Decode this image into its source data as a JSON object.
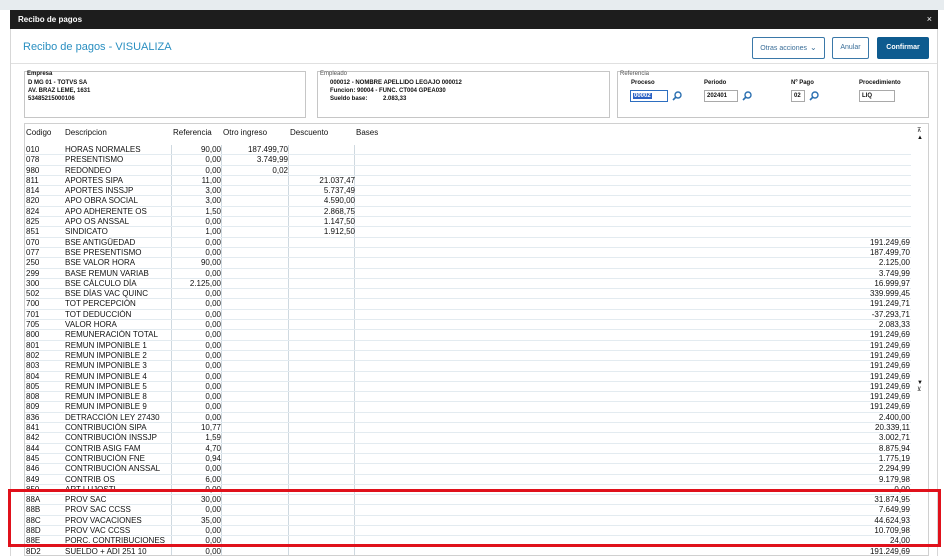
{
  "window": {
    "title": "Recibo de pagos",
    "close_glyph": "×"
  },
  "page": {
    "title": "Recibo de pagos - VISUALIZA"
  },
  "actions": {
    "otras_acciones": "Otras acciones",
    "anular": "Anular",
    "confirmar": "Confirmar"
  },
  "empresa": {
    "label": "Empresa",
    "line1": "D MG 01  - TOTVS SA",
    "line2": "AV. BRAZ LEME, 1631",
    "line3": "53485215000106"
  },
  "empleado": {
    "label": "Empleado",
    "line1": "000012 - NOMBRE  APELLIDO LEGAJO 000012",
    "line2": "Funcion: 90004 - FUNC. CT004 GPEA030",
    "sueldo_label": "Sueldo base:",
    "sueldo_value": "2.083,33"
  },
  "referencia": {
    "label": "Referencia",
    "proceso_label": "Proceso",
    "proceso_value": "00002",
    "periodo_label": "Periodo",
    "periodo_value": "202401",
    "nro_pago_label": "Nº Pago",
    "nro_pago_value": "02",
    "procedimiento_label": "Procedimiento",
    "procedimiento_value": "LIQ"
  },
  "grid": {
    "headers": {
      "codigo": "Codigo",
      "descripcion": "Descripcion",
      "referencia": "Referencia",
      "otro_ingreso": "Otro ingreso",
      "descuento": "Descuento",
      "bases": "Bases"
    },
    "rows": [
      {
        "codigo": "010",
        "descripcion": "HORAS NORMALES",
        "referencia": "90,00",
        "otro": "187.499,70",
        "descuento": "",
        "bases": ""
      },
      {
        "codigo": "078",
        "descripcion": "PRESENTISMO",
        "referencia": "0,00",
        "otro": "3.749,99",
        "descuento": "",
        "bases": ""
      },
      {
        "codigo": "980",
        "descripcion": "REDONDEO",
        "referencia": "0,00",
        "otro": "0,02",
        "descuento": "",
        "bases": ""
      },
      {
        "codigo": "811",
        "descripcion": "APORTES SIPA",
        "referencia": "11,00",
        "otro": "",
        "descuento": "21.037,47",
        "bases": ""
      },
      {
        "codigo": "814",
        "descripcion": "APORTES INSSJP",
        "referencia": "3,00",
        "otro": "",
        "descuento": "5.737,49",
        "bases": ""
      },
      {
        "codigo": "820",
        "descripcion": "APO OBRA SOCIAL",
        "referencia": "3,00",
        "otro": "",
        "descuento": "4.590,00",
        "bases": ""
      },
      {
        "codigo": "824",
        "descripcion": "APO ADHERENTE OS",
        "referencia": "1,50",
        "otro": "",
        "descuento": "2.868,75",
        "bases": ""
      },
      {
        "codigo": "825",
        "descripcion": "APO OS ANSSAL",
        "referencia": "0,00",
        "otro": "",
        "descuento": "1.147,50",
        "bases": ""
      },
      {
        "codigo": "851",
        "descripcion": "SINDICATO",
        "referencia": "1,00",
        "otro": "",
        "descuento": "1.912,50",
        "bases": ""
      },
      {
        "codigo": "070",
        "descripcion": "BSE ANTIGÜEDAD",
        "referencia": "0,00",
        "otro": "",
        "descuento": "",
        "bases": "191.249,69"
      },
      {
        "codigo": "077",
        "descripcion": "BSE PRESENTISMO",
        "referencia": "0,00",
        "otro": "",
        "descuento": "",
        "bases": "187.499,70"
      },
      {
        "codigo": "250",
        "descripcion": "BSE VALOR HORA",
        "referencia": "90,00",
        "otro": "",
        "descuento": "",
        "bases": "2.125,00"
      },
      {
        "codigo": "299",
        "descripcion": "BASE REMUN VARIAB",
        "referencia": "0,00",
        "otro": "",
        "descuento": "",
        "bases": "3.749,99"
      },
      {
        "codigo": "300",
        "descripcion": "BSE CÁLCULO DÍA",
        "referencia": "2.125,00",
        "otro": "",
        "descuento": "",
        "bases": "16.999,97"
      },
      {
        "codigo": "502",
        "descripcion": "BSE DÍAS VAC QUINC",
        "referencia": "0,00",
        "otro": "",
        "descuento": "",
        "bases": "339.999,45"
      },
      {
        "codigo": "700",
        "descripcion": "TOT PERCEPCIÓN",
        "referencia": "0,00",
        "otro": "",
        "descuento": "",
        "bases": "191.249,71"
      },
      {
        "codigo": "701",
        "descripcion": "TOT DEDUCCIÓN",
        "referencia": "0,00",
        "otro": "",
        "descuento": "",
        "bases": "-37.293,71"
      },
      {
        "codigo": "705",
        "descripcion": "VALOR HORA",
        "referencia": "0,00",
        "otro": "",
        "descuento": "",
        "bases": "2.083,33"
      },
      {
        "codigo": "800",
        "descripcion": "REMUNERACIÓN TOTAL",
        "referencia": "0,00",
        "otro": "",
        "descuento": "",
        "bases": "191.249,69"
      },
      {
        "codigo": "801",
        "descripcion": "REMUN IMPONIBLE 1",
        "referencia": "0,00",
        "otro": "",
        "descuento": "",
        "bases": "191.249,69"
      },
      {
        "codigo": "802",
        "descripcion": "REMUN IMPONIBLE 2",
        "referencia": "0,00",
        "otro": "",
        "descuento": "",
        "bases": "191.249,69"
      },
      {
        "codigo": "803",
        "descripcion": "REMUN IMPONIBLE 3",
        "referencia": "0,00",
        "otro": "",
        "descuento": "",
        "bases": "191.249,69"
      },
      {
        "codigo": "804",
        "descripcion": "REMUN IMPONIBLE 4",
        "referencia": "0,00",
        "otro": "",
        "descuento": "",
        "bases": "191.249,69"
      },
      {
        "codigo": "805",
        "descripcion": "REMUN IMPONIBLE 5",
        "referencia": "0,00",
        "otro": "",
        "descuento": "",
        "bases": "191.249,69"
      },
      {
        "codigo": "808",
        "descripcion": "REMUN IMPONIBLE 8",
        "referencia": "0,00",
        "otro": "",
        "descuento": "",
        "bases": "191.249,69"
      },
      {
        "codigo": "809",
        "descripcion": "REMUN IMPONIBLE 9",
        "referencia": "0,00",
        "otro": "",
        "descuento": "",
        "bases": "191.249,69"
      },
      {
        "codigo": "836",
        "descripcion": "DETRACCIÓN LEY 27430",
        "referencia": "0,00",
        "otro": "",
        "descuento": "",
        "bases": "2.400,00"
      },
      {
        "codigo": "841",
        "descripcion": "CONTRIBUCIÓN SIPA",
        "referencia": "10,77",
        "otro": "",
        "descuento": "",
        "bases": "20.339,11"
      },
      {
        "codigo": "842",
        "descripcion": "CONTRIBUCIÓN INSSJP",
        "referencia": "1,59",
        "otro": "",
        "descuento": "",
        "bases": "3.002,71"
      },
      {
        "codigo": "844",
        "descripcion": "CONTRIB ASIG FAM",
        "referencia": "4,70",
        "otro": "",
        "descuento": "",
        "bases": "8.875,94"
      },
      {
        "codigo": "845",
        "descripcion": "CONTRIBUCIÓN FNE",
        "referencia": "0,94",
        "otro": "",
        "descuento": "",
        "bases": "1.775,19"
      },
      {
        "codigo": "846",
        "descripcion": "CONTRIBUCIÓN ANSSAL",
        "referencia": "0,00",
        "otro": "",
        "descuento": "",
        "bases": "2.294,99"
      },
      {
        "codigo": "849",
        "descripcion": "CONTRIB OS",
        "referencia": "6,00",
        "otro": "",
        "descuento": "",
        "bases": "9.179,98"
      },
      {
        "codigo": "850",
        "descripcion": "ART LUJOSTL",
        "referencia": "0,00",
        "otro": "",
        "descuento": "",
        "bases": "0,00"
      },
      {
        "codigo": "88A",
        "descripcion": "PROV SAC",
        "referencia": "30,00",
        "otro": "",
        "descuento": "",
        "bases": "31.874,95"
      },
      {
        "codigo": "88B",
        "descripcion": "PROV SAC CCSS",
        "referencia": "0,00",
        "otro": "",
        "descuento": "",
        "bases": "7.649,99"
      },
      {
        "codigo": "88C",
        "descripcion": "PROV VACACIONES",
        "referencia": "35,00",
        "otro": "",
        "descuento": "",
        "bases": "44.624,93"
      },
      {
        "codigo": "88D",
        "descripcion": "PROV VAC CCSS",
        "referencia": "0,00",
        "otro": "",
        "descuento": "",
        "bases": "10.709,98"
      },
      {
        "codigo": "88E",
        "descripcion": "PORC. CONTRIBUCIONES",
        "referencia": "0,00",
        "otro": "",
        "descuento": "",
        "bases": "24,00"
      },
      {
        "codigo": "8D2",
        "descripcion": "SUELDO + ADI 251 10",
        "referencia": "0,00",
        "otro": "",
        "descuento": "",
        "bases": "191.249,69"
      }
    ]
  },
  "icons": {
    "lookup": "magnifier-icon",
    "scroll_top": "first-page-icon",
    "scroll_up": "page-up-icon",
    "scroll_down": "page-down-icon",
    "scroll_bottom": "last-page-icon"
  },
  "colors": {
    "accent": "#2a8fc1",
    "confirm": "#0e5b8f",
    "highlight": "#e0111b",
    "titlebar": "#1d1d1d"
  }
}
